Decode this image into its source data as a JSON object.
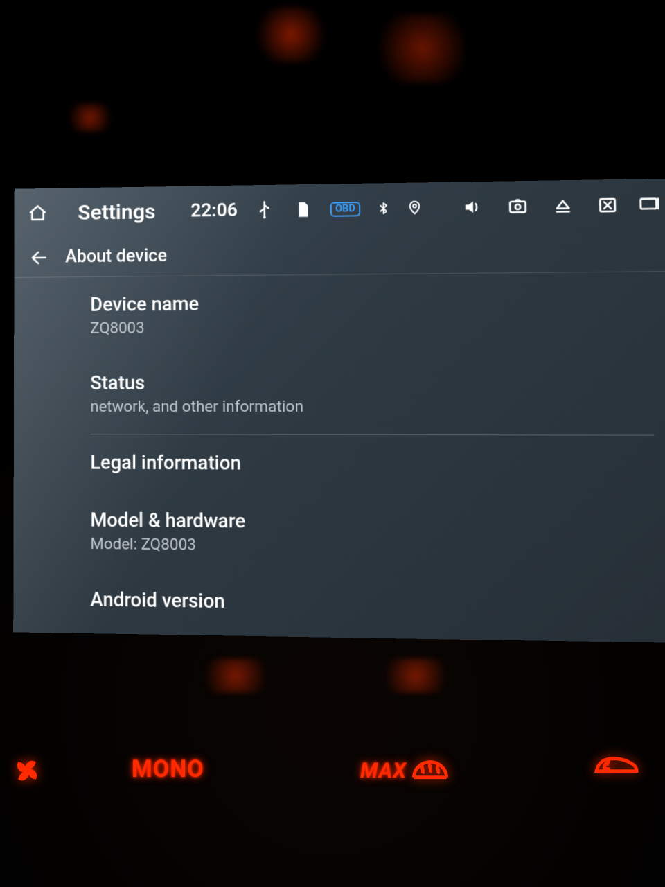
{
  "statusbar": {
    "title": "Settings",
    "time": "22:06",
    "obd_label": "OBD"
  },
  "subheader": {
    "title": "About device"
  },
  "items": {
    "device_name": {
      "title": "Device name",
      "sub": "ZQ8003"
    },
    "status": {
      "title": "Status",
      "sub": "network, and other information"
    },
    "legal": {
      "title": "Legal information"
    },
    "model": {
      "title": "Model & hardware",
      "sub": "Model: ZQ8003"
    },
    "android": {
      "title": "Android version"
    }
  },
  "hardware": {
    "mono": "MONO",
    "max": "MAX"
  }
}
